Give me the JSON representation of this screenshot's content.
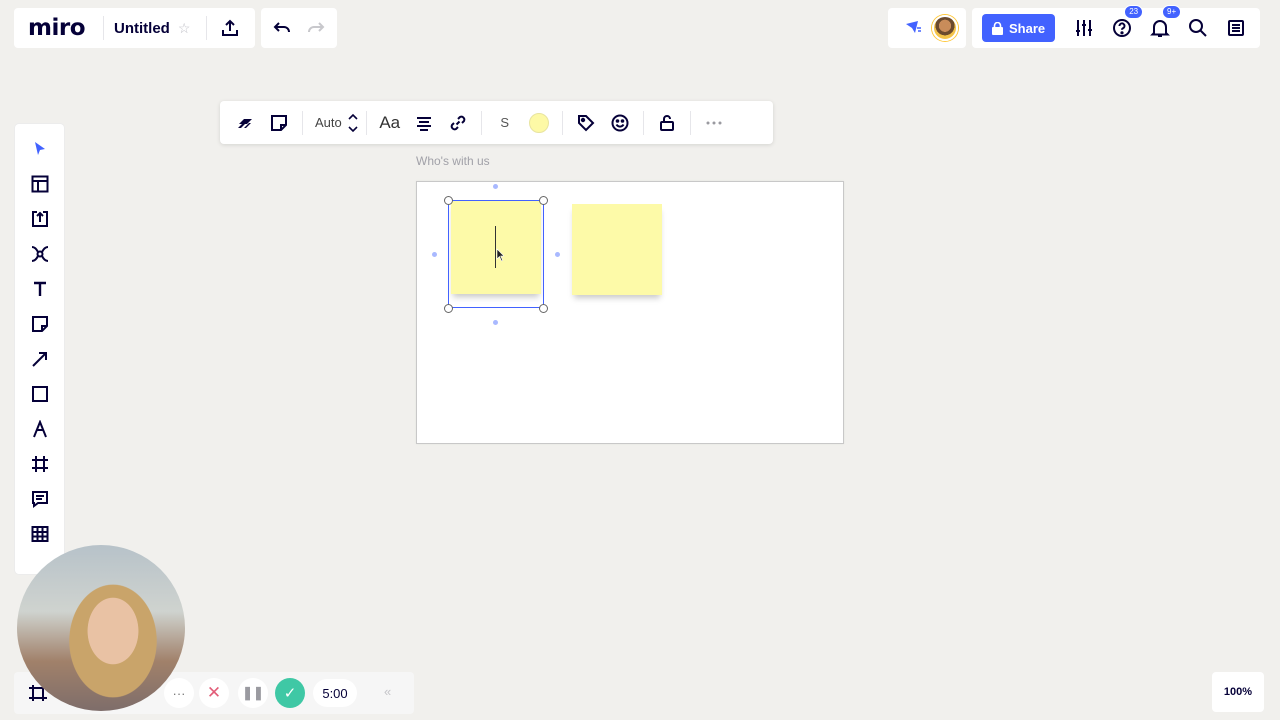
{
  "app": {
    "logo": "miro",
    "board_title": "Untitled",
    "star": "☆"
  },
  "top_right": {
    "share_label": "Share",
    "help_badge": "23",
    "notifications_badge": "9+"
  },
  "context_toolbar": {
    "size_mode": "Auto",
    "font_label": "Aa",
    "font_size_label": "S",
    "sticky_color": "#fdf9a6"
  },
  "canvas": {
    "frame_title": "Who's with us",
    "sticky_color": "#fdfaa8",
    "selection_color": "#4262ff"
  },
  "timer": {
    "more_label": "···",
    "cancel_label": "✕",
    "pause_label": "❚❚",
    "done_label": "✓",
    "time": "5:00",
    "collapse_label": "«"
  },
  "zoom": {
    "level": "100%"
  },
  "colors": {
    "accent": "#4262ff",
    "timer_done": "#3fc8a5",
    "cancel": "#e25d78",
    "background": "#f1f0ed"
  }
}
